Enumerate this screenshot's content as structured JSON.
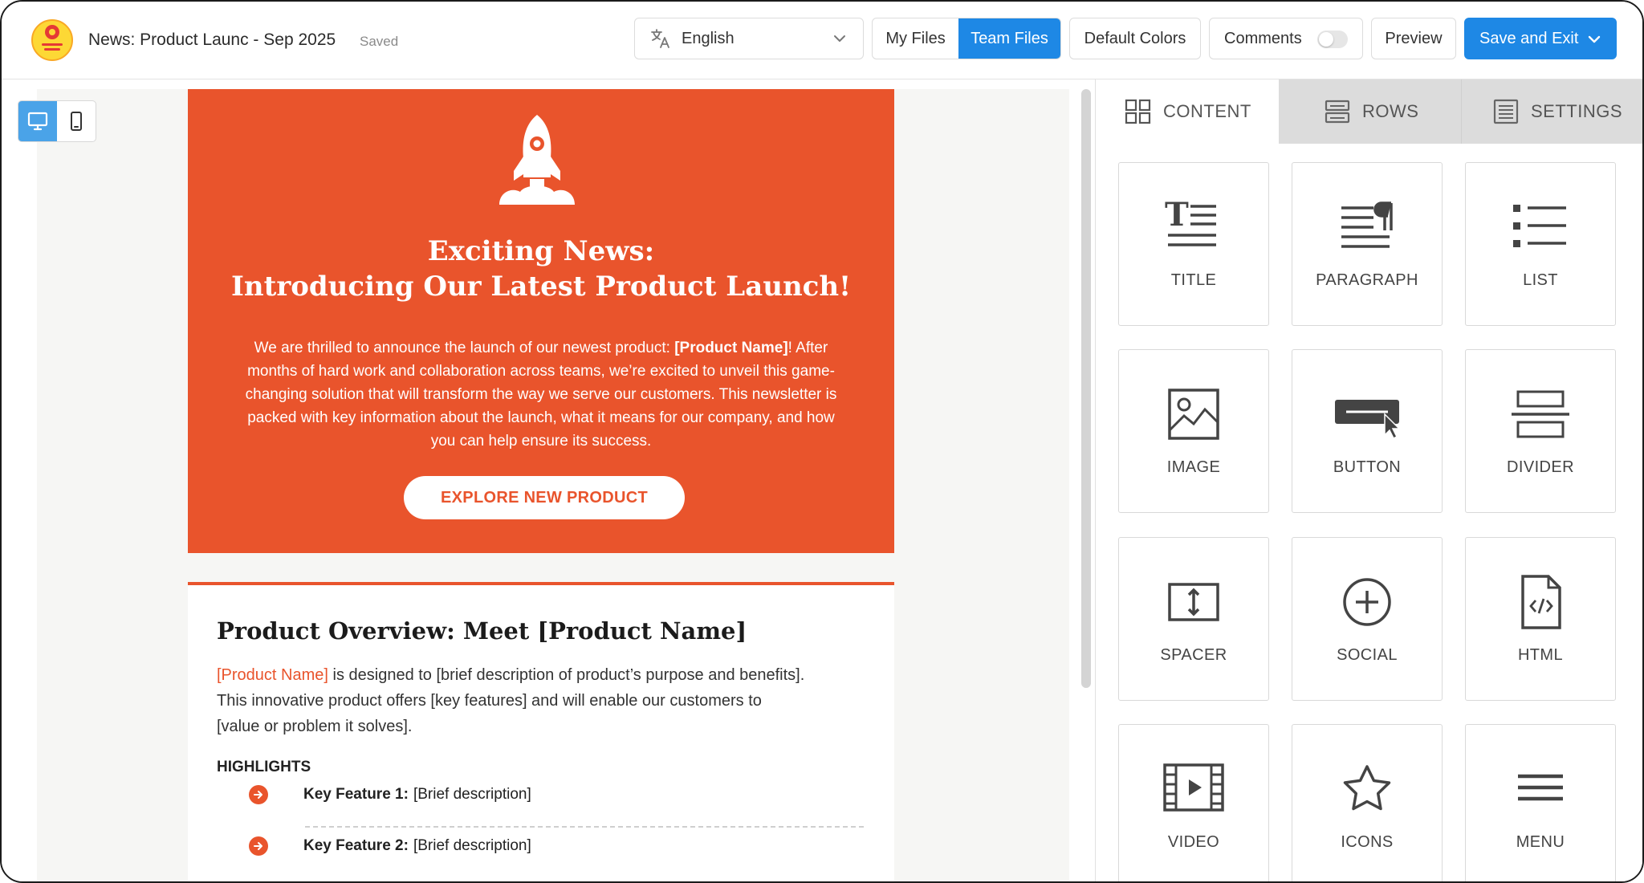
{
  "header": {
    "document_title": "News: Product Launc - Sep 2025",
    "save_status": "Saved",
    "language": "English",
    "my_files_label": "My Files",
    "team_files_label": "Team Files",
    "default_colors_label": "Default Colors",
    "comments_label": "Comments",
    "comments_enabled": false,
    "preview_label": "Preview",
    "save_exit_label": "Save and Exit"
  },
  "canvas": {
    "view_mode": "desktop",
    "hero": {
      "heading_line1": "Exciting News:",
      "heading_line2": "Introducing Our Latest Product Launch!",
      "para_part1": "We are thrilled to announce the launch of our newest product: ",
      "para_bold": "[Product Name]",
      "para_part2": "! After months of hard work and collaboration across teams, we’re excited to unveil this game-changing solution that will transform the way we serve our customers. This newsletter is packed with key information about the launch, what it means for our company, and how you can help ensure its success.",
      "cta_label": "EXPLORE NEW PRODUCT"
    },
    "overview": {
      "heading": "Product Overview: Meet [Product Name]",
      "para_accent": "[Product Name]",
      "para_line1_rest": " is designed to [brief description of product’s purpose and benefits].",
      "para_line2": "This innovative product offers [key features] and will enable our customers to",
      "para_line3": "[value or problem it solves].",
      "highlights_label": "HIGHLIGHTS",
      "features": [
        {
          "label": "Key Feature 1:",
          "desc": "[Brief description]"
        },
        {
          "label": "Key Feature 2:",
          "desc": "[Brief description]"
        }
      ]
    }
  },
  "panel": {
    "tabs": [
      {
        "label": "CONTENT",
        "icon": "grid-icon",
        "active": true
      },
      {
        "label": "ROWS",
        "icon": "rows-icon",
        "active": false
      },
      {
        "label": "SETTINGS",
        "icon": "settings-icon",
        "active": false
      }
    ],
    "blocks": [
      {
        "label": "TITLE",
        "icon": "title-icon"
      },
      {
        "label": "PARAGRAPH",
        "icon": "paragraph-icon"
      },
      {
        "label": "LIST",
        "icon": "list-icon"
      },
      {
        "label": "IMAGE",
        "icon": "image-icon"
      },
      {
        "label": "BUTTON",
        "icon": "button-icon"
      },
      {
        "label": "DIVIDER",
        "icon": "divider-icon"
      },
      {
        "label": "SPACER",
        "icon": "spacer-icon"
      },
      {
        "label": "SOCIAL",
        "icon": "social-icon"
      },
      {
        "label": "HTML",
        "icon": "html-icon"
      },
      {
        "label": "VIDEO",
        "icon": "video-icon"
      },
      {
        "label": "ICONS",
        "icon": "star-icon"
      },
      {
        "label": "MENU",
        "icon": "menu-icon"
      }
    ]
  },
  "colors": {
    "accent_orange": "#e9542c",
    "primary_blue": "#1e88e5",
    "view_toggle_active": "#4aa3e8"
  }
}
